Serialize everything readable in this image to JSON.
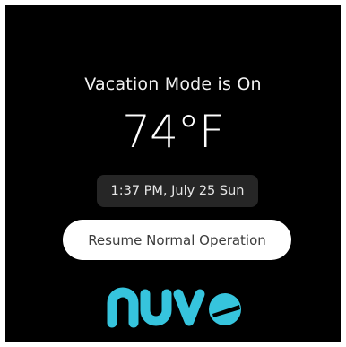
{
  "screen": {
    "headline": "Vacation Mode is On",
    "temperature": "74°F",
    "datetime": "1:37 PM, July 25 Sun"
  },
  "actions": {
    "resume_label": "Resume Normal Operation"
  },
  "brand": {
    "logo_text": "nuve",
    "logo_color": "#36c4dd"
  },
  "colors": {
    "background": "#000000",
    "pill_background": "#262626",
    "button_background": "#ffffff",
    "button_text": "#3c3c3c"
  }
}
